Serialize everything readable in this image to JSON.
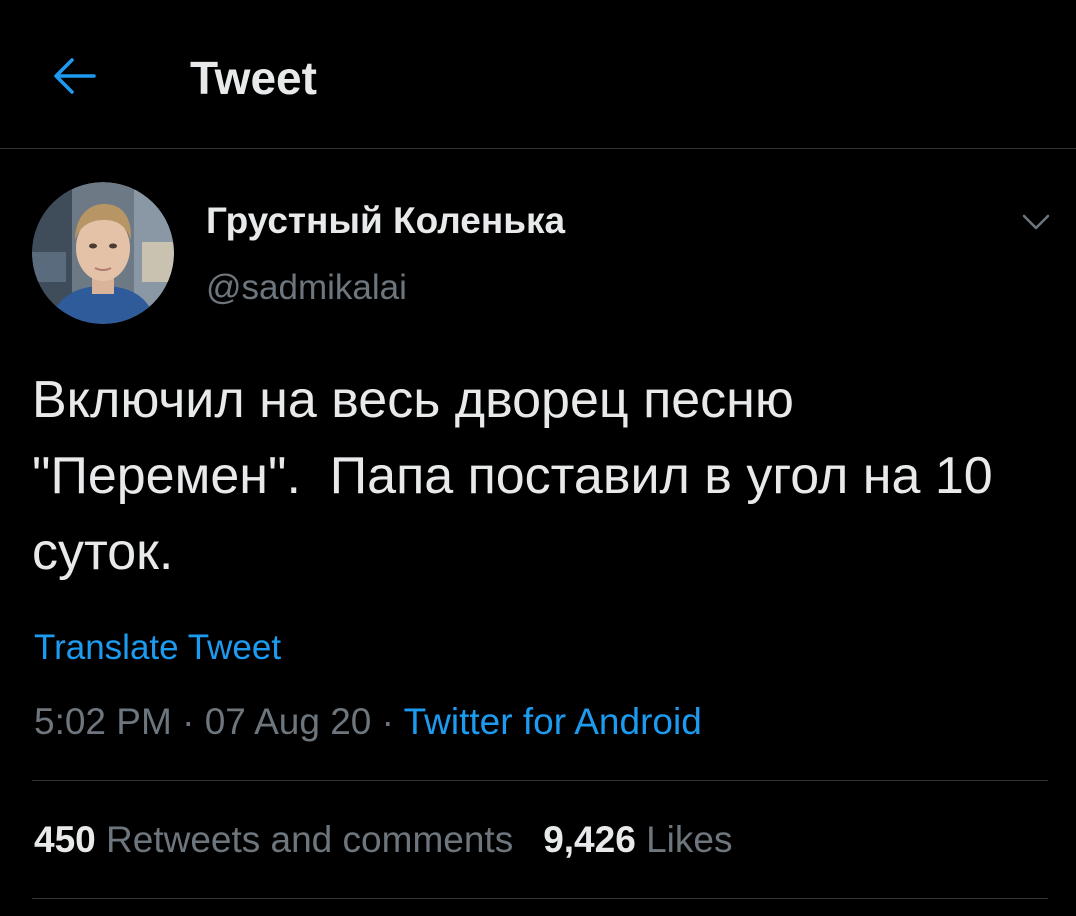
{
  "header": {
    "title": "Tweet",
    "back_icon": "arrow-left-icon"
  },
  "author": {
    "display_name": "Грустный Коленька",
    "handle": "@sadmikalai",
    "avatar_icon": "user-avatar"
  },
  "tweet": {
    "text": "Включил на весь дворец песню \"Перемен\".  Папа поставил в угол на 10 суток.",
    "translate_label": "Translate Tweet",
    "time": "5:02 PM",
    "date": "07 Aug 20",
    "separator": "·",
    "source": "Twitter for Android",
    "menu_icon": "chevron-down-icon"
  },
  "stats": {
    "retweets_count": "450",
    "retweets_label": "Retweets and comments",
    "likes_count": "9,426",
    "likes_label": "Likes"
  },
  "colors": {
    "background": "#000000",
    "text_primary": "#e7e9ea",
    "text_secondary": "#6e767d",
    "accent": "#1d9bf0",
    "divider": "#2f3336"
  }
}
